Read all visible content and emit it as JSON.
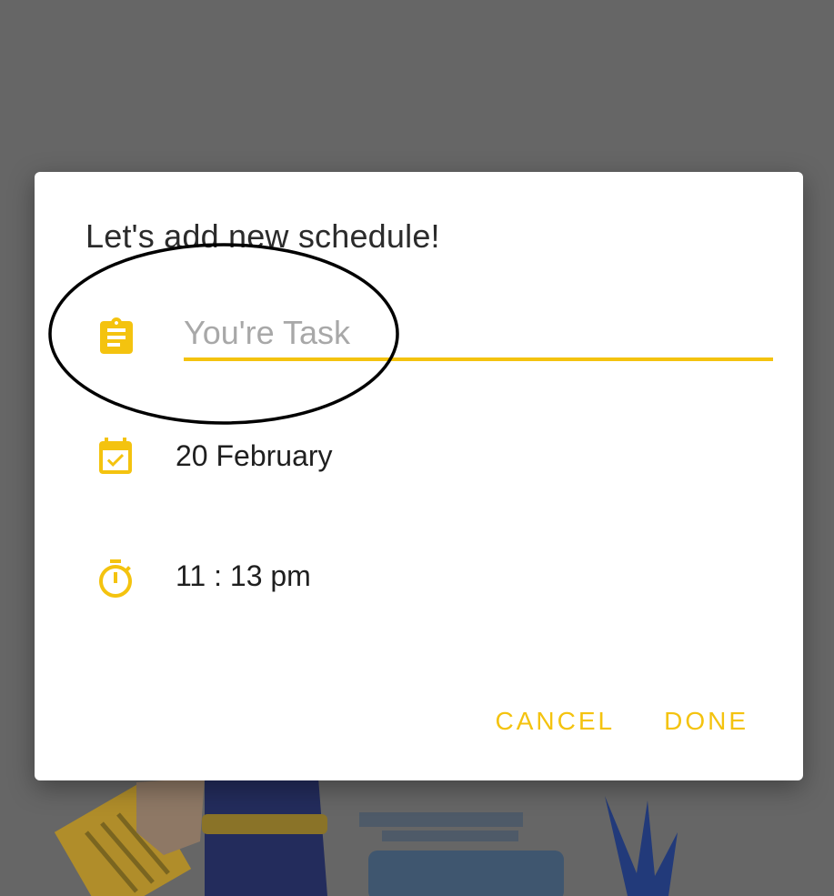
{
  "dialog": {
    "title": "Let's add new schedule!",
    "task_input": {
      "value": "",
      "placeholder": "You're Task",
      "icon": "clipboard-icon"
    },
    "date": {
      "value": "20 February",
      "icon": "calendar-check-icon"
    },
    "time": {
      "value": "11 : 13 pm",
      "icon": "stopwatch-icon"
    },
    "actions": {
      "cancel_label": "CANCEL",
      "done_label": "DONE"
    }
  },
  "colors": {
    "accent": "#f4c30f",
    "scrim": "#666666",
    "dialog_background": "#ffffff",
    "title_text": "#2b2b2b",
    "placeholder_text": "#a8a8a8"
  }
}
